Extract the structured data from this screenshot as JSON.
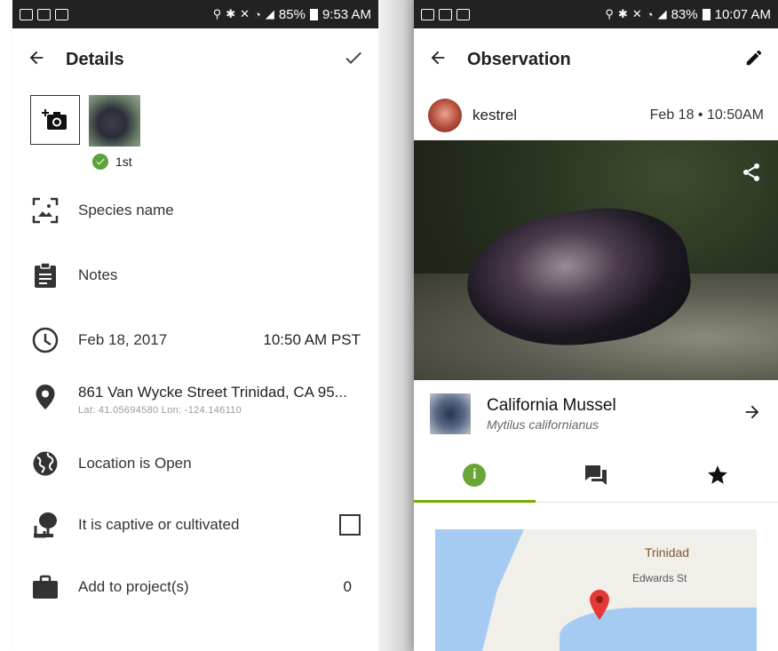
{
  "left": {
    "status": {
      "battery": "85%",
      "time": "9:53 AM"
    },
    "header": {
      "title": "Details"
    },
    "photo": {
      "label": "1st"
    },
    "rows": {
      "species": "Species name",
      "notes": "Notes",
      "date": "Feb 18, 2017",
      "time": "10:50 AM PST",
      "address": "861 Van Wycke Street Trinidad, CA 95...",
      "coords": "Lat: 41.05694580  Lon: -124.146110",
      "geoprivacy": "Location is Open",
      "captive": "It is captive or cultivated",
      "projects": "Add to project(s)",
      "projects_count": "0"
    }
  },
  "right": {
    "status": {
      "battery": "83%",
      "time": "10:07 AM"
    },
    "header": {
      "title": "Observation"
    },
    "user": {
      "name": "kestrel",
      "date": "Feb 18 • 10:50AM"
    },
    "taxon": {
      "common": "California Mussel",
      "scientific": "Mytilus californianus"
    },
    "map": {
      "place": "Trinidad",
      "street": "Edwards St"
    }
  },
  "colors": {
    "accent": "#74ac00",
    "check": "#5ba33b",
    "pin": "#e53935",
    "water": "#a6cbf2"
  }
}
